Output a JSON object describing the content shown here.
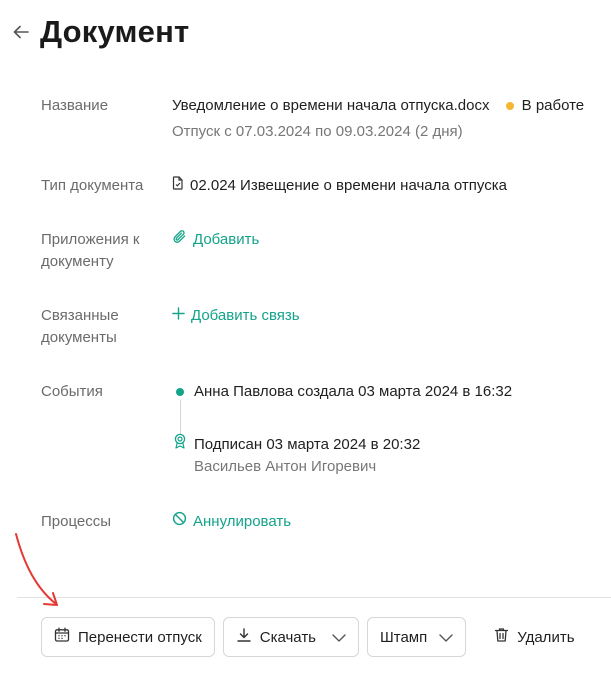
{
  "header": {
    "title": "Документ"
  },
  "fields": {
    "name": {
      "label": "Название",
      "value": "Уведомление о времени начала отпуска.docx",
      "status": "В работе",
      "subtitle": "Отпуск с 07.03.2024 по 09.03.2024 (2 дня)"
    },
    "doc_type": {
      "label": "Тип документа",
      "value": "02.024 Извещение о времени начала отпуска"
    },
    "attachments": {
      "label_line1": "Приложения к",
      "label_line2": "документу",
      "action": "Добавить"
    },
    "related": {
      "label_line1": "Связанные",
      "label_line2": "документы",
      "action": "Добавить связь"
    },
    "events": {
      "label": "События",
      "items": [
        {
          "text": "Анна Павлова создала 03 марта 2024 в 16:32"
        },
        {
          "text": "Подписан 03 марта 2024 в 20:32",
          "subtext": "Васильев Антон Игоревич"
        }
      ]
    },
    "processes": {
      "label": "Процессы",
      "action": "Аннулировать"
    }
  },
  "toolbar": {
    "reschedule": "Перенести отпуск",
    "download": "Скачать",
    "stamp": "Штамп",
    "delete": "Удалить"
  },
  "colors": {
    "accent": "#14a38b",
    "status_dot": "#f5b731",
    "annotation_arrow": "#e53935"
  }
}
